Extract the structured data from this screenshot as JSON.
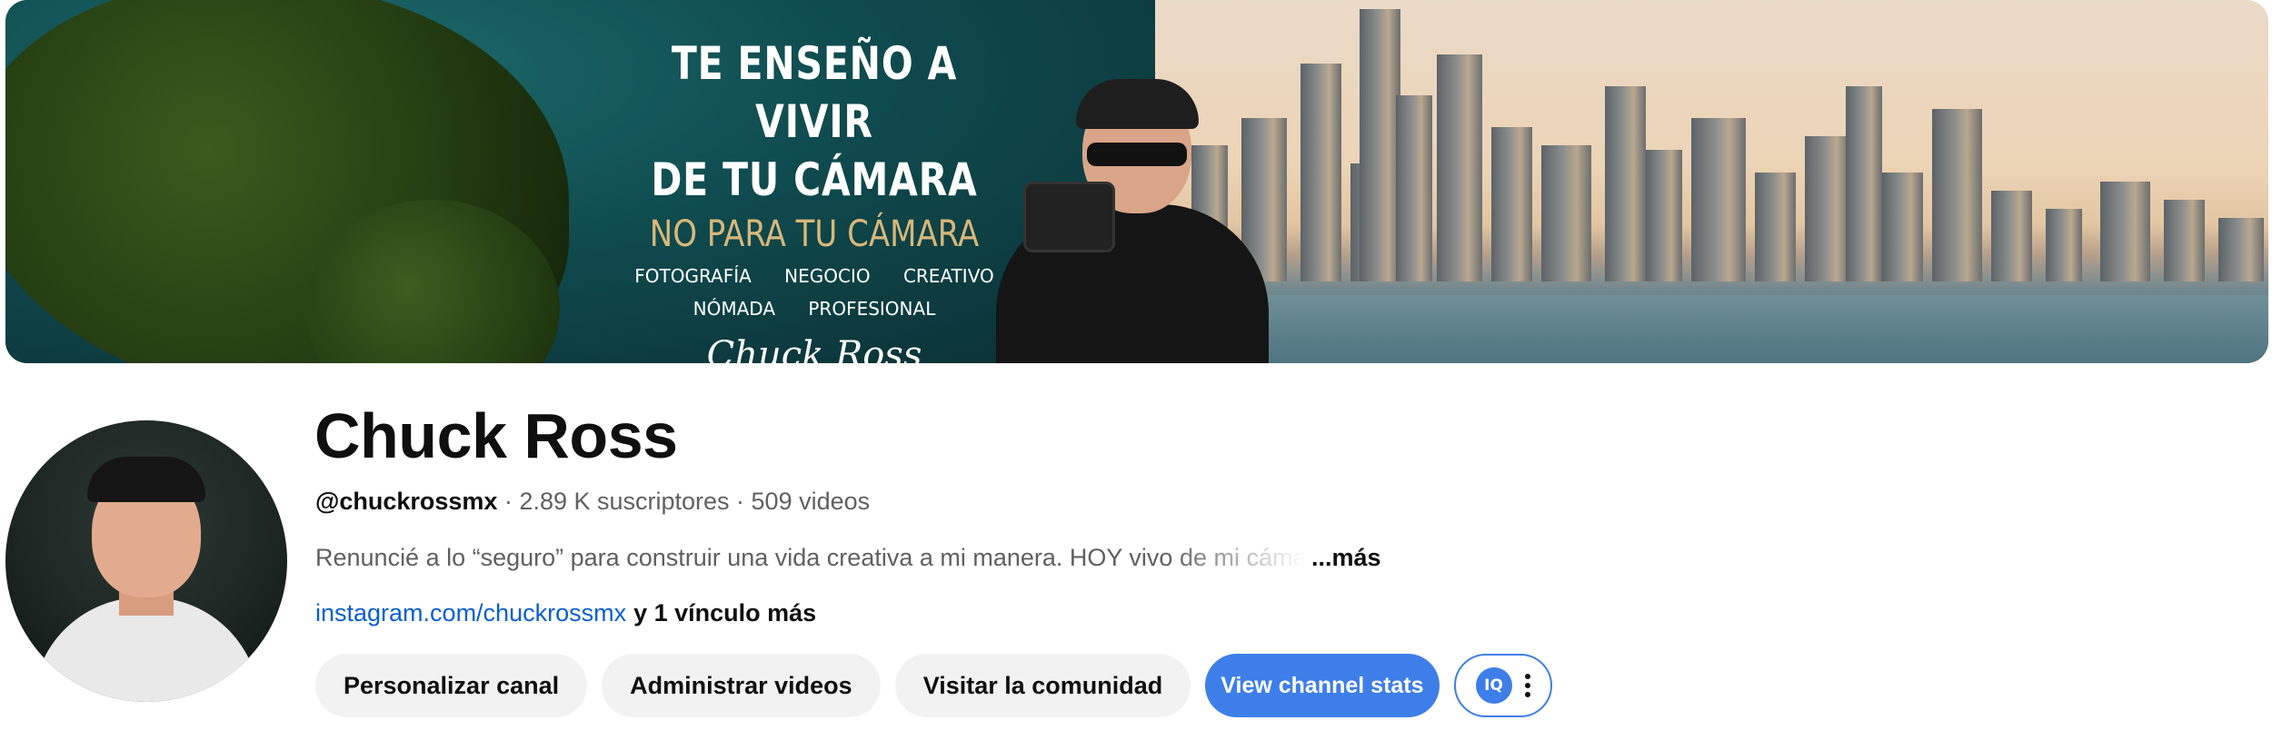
{
  "banner": {
    "line1": "TE ENSEÑO A VIVIR",
    "line2": "DE TU CÁMARA",
    "line3": "NO PARA TU CÁMARA",
    "line4": "FOTOGRAFÍA NEGOCIO CREATIVO",
    "line5": "NÓMADA PROFESIONAL",
    "signature": "Chuck Ross"
  },
  "channel": {
    "name": "Chuck Ross",
    "handle": "@chuckrossmx",
    "subscribers": "2.89 K suscriptores",
    "videos": "509 videos",
    "separator": " · ",
    "description": "Renuncié a lo “seguro” para construir una vida creativa a mi manera. HOY vivo de mi cámara",
    "more_label": "...más",
    "link_text": "instagram.com/chuckrossmx",
    "more_links": "y 1 vínculo más"
  },
  "actions": {
    "customize": "Personalizar canal",
    "manage_videos": "Administrar videos",
    "visit_community": "Visitar la comunidad",
    "view_stats": "View channel stats",
    "extension_logo": "IQ"
  },
  "colors": {
    "link": "#065fd4",
    "primary_button": "#3e7ee8",
    "secondary_button_bg": "#f2f2f2",
    "text_secondary": "#606060"
  },
  "icons": {
    "extension": "vidiq-logo-icon",
    "menu": "more-vert-icon"
  }
}
